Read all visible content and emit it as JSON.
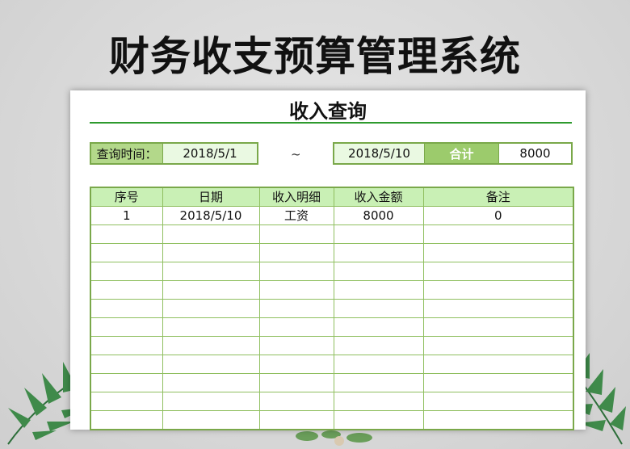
{
  "app_title": "财务收支预算管理系统",
  "sheet": {
    "title": "收入查询",
    "query": {
      "label": "查询时间：",
      "start_date": "2018/5/1",
      "separator": "~",
      "end_date": "2018/5/10",
      "total_label": "合计",
      "total_value": "8000"
    },
    "table": {
      "headers": [
        "序号",
        "日期",
        "收入明细",
        "收入金额",
        "备注"
      ],
      "rows": [
        [
          "1",
          "2018/5/10",
          "工资",
          "8000",
          "0"
        ],
        [
          "",
          "",
          "",
          "",
          ""
        ],
        [
          "",
          "",
          "",
          "",
          ""
        ],
        [
          "",
          "",
          "",
          "",
          ""
        ],
        [
          "",
          "",
          "",
          "",
          ""
        ],
        [
          "",
          "",
          "",
          "",
          ""
        ],
        [
          "",
          "",
          "",
          "",
          ""
        ],
        [
          "",
          "",
          "",
          "",
          ""
        ],
        [
          "",
          "",
          "",
          "",
          ""
        ],
        [
          "",
          "",
          "",
          "",
          ""
        ],
        [
          "",
          "",
          "",
          "",
          ""
        ],
        [
          "",
          "",
          "",
          "",
          ""
        ]
      ]
    }
  },
  "colors": {
    "accent_green": "#2e9a2e",
    "header_fill": "#c9f0b5",
    "label_fill": "#b3d88a",
    "sum_fill": "#9ccb6c",
    "value_fill": "#eaf9e2",
    "border": "#7aa84a"
  },
  "decorations": [
    "palm-leaf-left",
    "palm-leaf-right"
  ]
}
